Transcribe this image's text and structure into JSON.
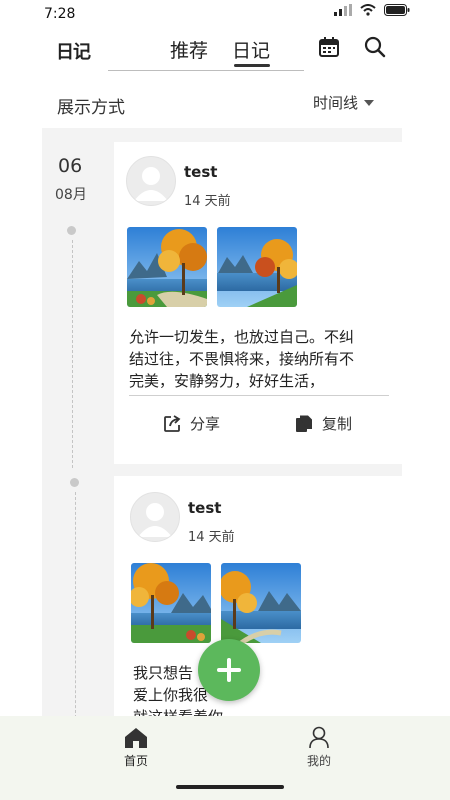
{
  "status_bar": {
    "time": "7:28"
  },
  "header": {
    "logo": "日记",
    "tabs": [
      {
        "label": "推荐"
      },
      {
        "label": "日记"
      }
    ],
    "icons": {
      "calendar": "calendar-icon",
      "search": "search-icon"
    }
  },
  "display_mode": {
    "label": "展示方式",
    "value": "时间线"
  },
  "timeline": {
    "day": "06",
    "month": "08月"
  },
  "posts": [
    {
      "user": "test",
      "time": "14 天前",
      "text_lines": [
        "允许一切发生，也放过自己。不纠",
        "结过往，不畏惧将来，接纳所有不",
        "完美，安静努力，好好生活，"
      ],
      "actions": {
        "share": "分享",
        "copy": "复制"
      }
    },
    {
      "user": "test",
      "time": "14 天前",
      "text_lines": [
        "我只想告",
        "爱上你我很",
        "就这样看着你"
      ]
    }
  ],
  "bottom_nav": [
    {
      "label": "首页",
      "icon": "home-icon"
    },
    {
      "label": "我的",
      "icon": "profile-icon"
    }
  ],
  "colors": {
    "accent": "#5cb85c",
    "feed_bg": "#f3f3f3",
    "nav_bg": "#f3f6ef"
  }
}
